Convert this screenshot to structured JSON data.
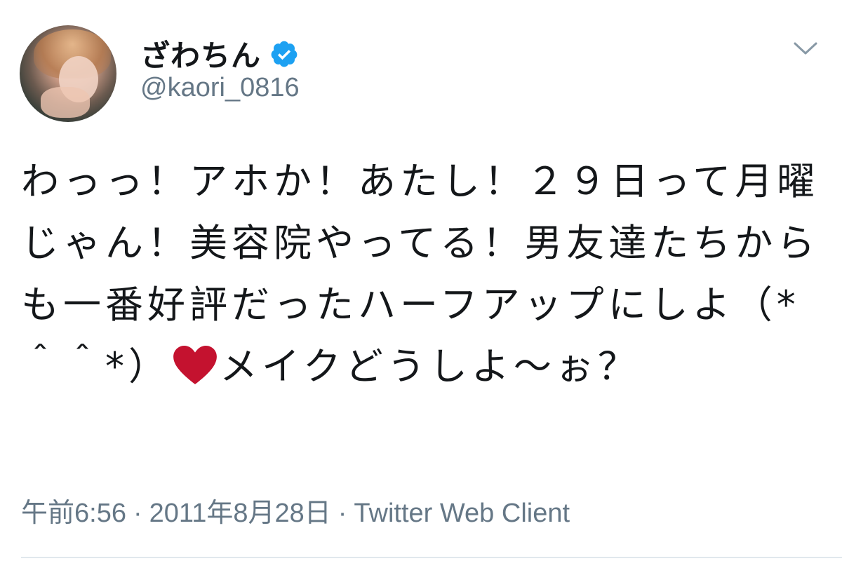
{
  "user": {
    "display_name": "ざわちん",
    "handle": "@kaori_0816",
    "verified": true
  },
  "tweet": {
    "text_part1": "わっっ！アホか！あたし！２９日って月曜じゃん！美容院やってる！男友達たちからも一番好評だったハーフアップにしよ（*＾＾*）",
    "heart_icon": "red-heart-emoji",
    "text_part2": "メイクどうしよ〜ぉ？"
  },
  "meta": {
    "time": "午前6:56",
    "separator": "·",
    "date": "2011年8月28日",
    "source": "Twitter Web Client"
  },
  "colors": {
    "verified_blue": "#1da1f2",
    "heart_red": "#c4122f",
    "secondary_text": "#657786"
  },
  "icons": {
    "menu": "chevron-down-icon",
    "verified": "verified-badge-icon"
  }
}
